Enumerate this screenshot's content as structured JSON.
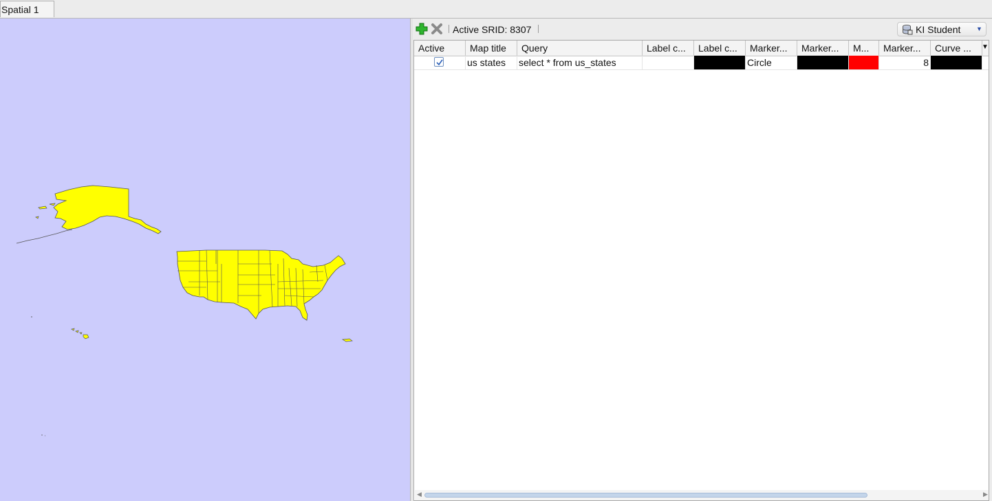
{
  "tabs": [
    {
      "label": "Spatial 1"
    }
  ],
  "toolbar": {
    "srid_label": "Active SRID: 8307",
    "connection": "KI Student"
  },
  "grid": {
    "columns": [
      "Active",
      "Map title",
      "Query",
      "Label c...",
      "Label c...",
      "Marker...",
      "Marker...",
      "M...",
      "Marker...",
      "Curve ..."
    ],
    "rows": [
      {
        "active": true,
        "map_title": "us states",
        "query": "select * from us_states",
        "label_column": "",
        "label_color": "#000000",
        "marker_shape": "Circle",
        "marker_color": "#000000",
        "marker_fill": "#ff0000",
        "marker_size": "8",
        "curve_color": "#000000"
      }
    ]
  },
  "map": {
    "background": "#ccccfc",
    "fill": "#ffff00",
    "stroke": "#555555"
  },
  "icons": {
    "add": "green-plus-icon",
    "remove": "gray-x-icon",
    "connection": "database-icon",
    "column_menu": "chevron-down-icon"
  }
}
